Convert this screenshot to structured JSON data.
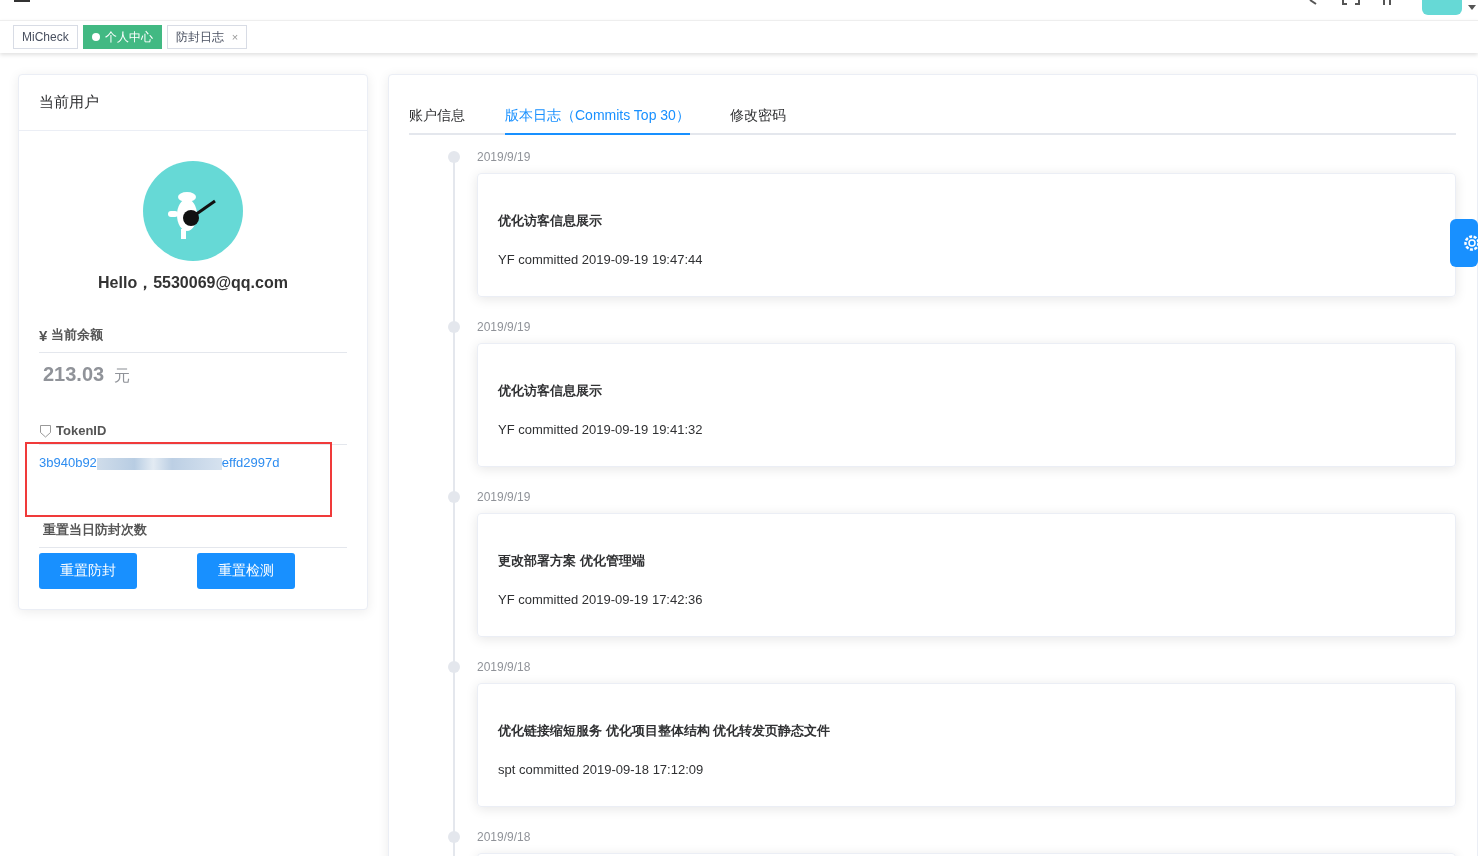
{
  "tags": [
    {
      "label": "MiCheck",
      "selected": false
    },
    {
      "label": "个人中心",
      "selected": true
    },
    {
      "label": "防封日志",
      "selected": false,
      "close_mark": "×"
    }
  ],
  "user": {
    "title": "当前用户",
    "greeting": "Hello，5530069@qq.com",
    "currency_mark": "¥",
    "balance_label": "当前余额",
    "balance": "213.03",
    "unit": "元",
    "token_label": "TokenID",
    "token_start": "3b940b92",
    "token_end": "effd2997d",
    "reset_label": "重置当日防封次数",
    "buttons": [
      "重置防封",
      "重置检测"
    ]
  },
  "tabs": [
    {
      "label": "账户信息",
      "selected": false
    },
    {
      "label": "版本日志（Commits Top 30）",
      "selected": true
    },
    {
      "label": "修改密码",
      "selected": false
    }
  ],
  "commits": [
    {
      "date": "2019/9/19",
      "message": "优化访客信息展示",
      "meta": "YF committed 2019-09-19 19:47:44"
    },
    {
      "date": "2019/9/19",
      "message": "优化访客信息展示",
      "meta": "YF committed 2019-09-19 19:41:32"
    },
    {
      "date": "2019/9/19",
      "message": "更改部署方案 优化管理端",
      "meta": "YF committed 2019-09-19 17:42:36"
    },
    {
      "date": "2019/9/18",
      "message": "优化链接缩短服务 优化项目整体结构 优化转发页静态文件",
      "meta": "spt committed 2019-09-18 17:12:09"
    },
    {
      "date": "2019/9/18"
    }
  ]
}
